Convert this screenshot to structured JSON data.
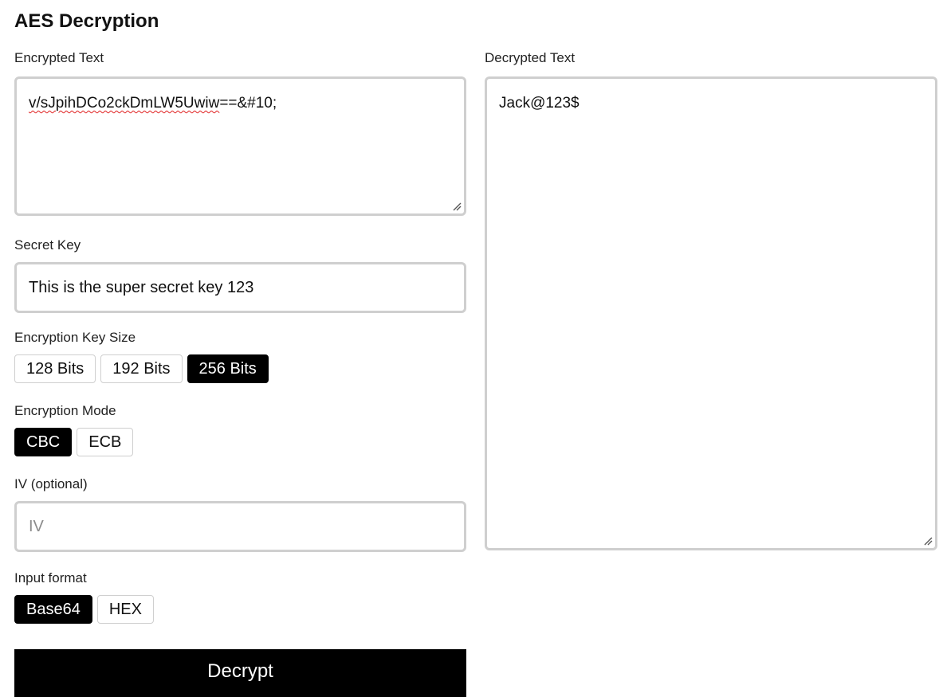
{
  "page": {
    "title": "AES Decryption"
  },
  "encrypted": {
    "label": "Encrypted Text",
    "value_underlined": "v/sJpihDCo2ckDmLW5Uwiw",
    "value_rest": "==&#10;"
  },
  "secret_key": {
    "label": "Secret Key",
    "value": "This is the super secret key 123"
  },
  "key_size": {
    "label": "Encryption Key Size",
    "options": [
      "128 Bits",
      "192 Bits",
      "256 Bits"
    ],
    "selected": "256 Bits"
  },
  "mode": {
    "label": "Encryption Mode",
    "options": [
      "CBC",
      "ECB"
    ],
    "selected": "CBC"
  },
  "iv": {
    "label": "IV (optional)",
    "value": "",
    "placeholder": "IV"
  },
  "input_format": {
    "label": "Input format",
    "options": [
      "Base64",
      "HEX"
    ],
    "selected": "Base64"
  },
  "decrypted": {
    "label": "Decrypted Text",
    "value": "Jack@123$"
  },
  "actions": {
    "decrypt_label": "Decrypt"
  },
  "colors": {
    "accent": "#000000",
    "border": "#cfcfcf",
    "spellcheck": "#e02020"
  }
}
